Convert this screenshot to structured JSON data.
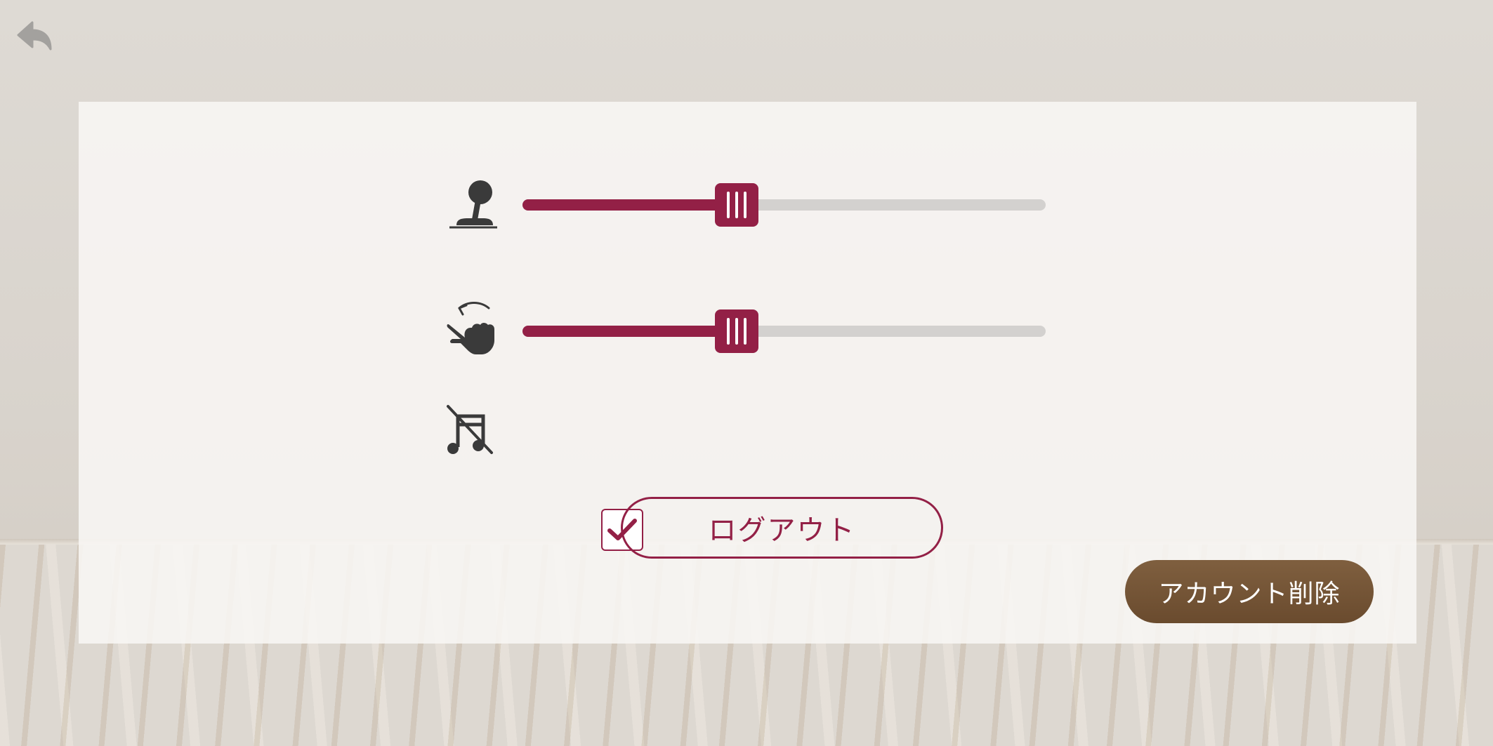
{
  "toolbar": {
    "back_icon": "back-arrow-icon"
  },
  "settings": {
    "joystick_sensitivity": {
      "icon": "joystick-icon",
      "value_fraction": 0.41
    },
    "swipe_sensitivity": {
      "icon": "swipe-gesture-icon",
      "value_fraction": 0.41
    },
    "mute_music": {
      "icon": "music-muted-icon",
      "checked": true
    }
  },
  "buttons": {
    "logout_label": "ログアウト",
    "delete_account_label": "アカウント削除"
  },
  "colors": {
    "accent": "#932046",
    "track": "#d3d1cf",
    "delete_button": "#6f5033",
    "icon": "#3a3a3a",
    "back_icon": "#a3a19e"
  }
}
